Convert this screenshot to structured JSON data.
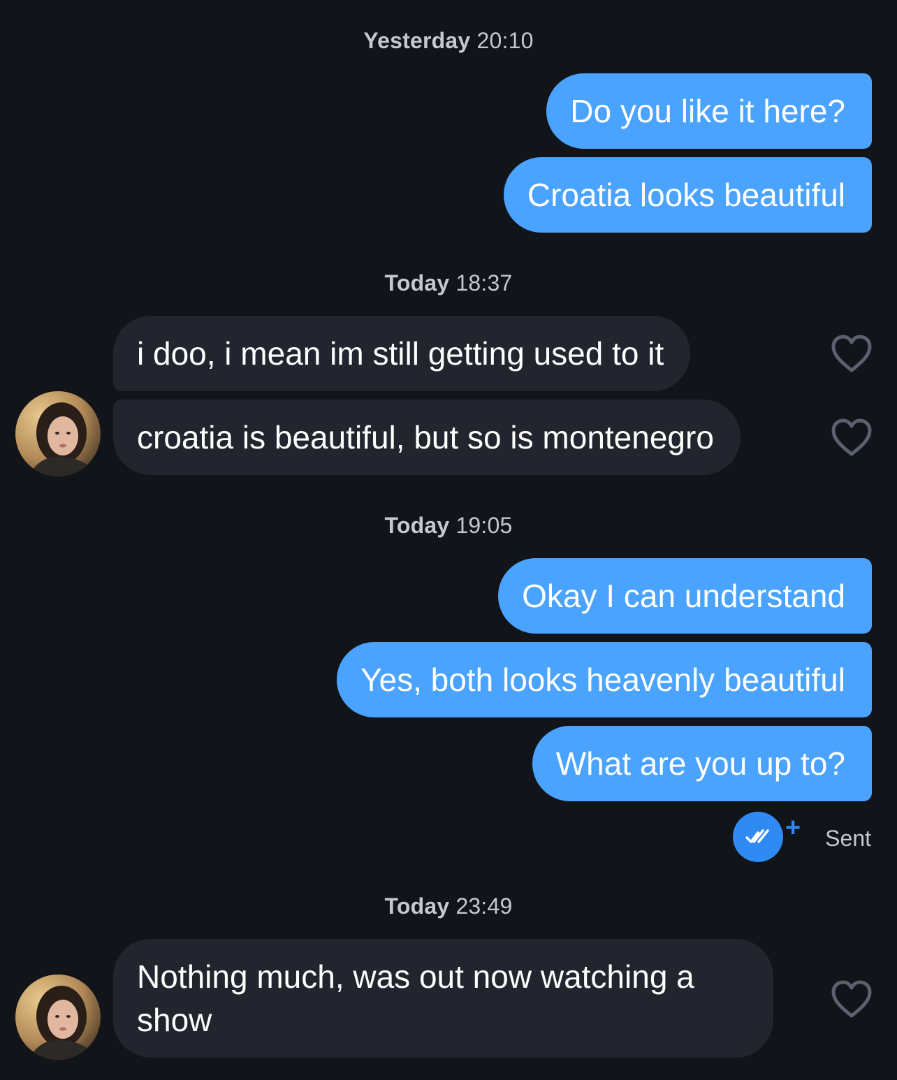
{
  "conversation": {
    "groups": [
      {
        "timestamp_day": "Yesterday",
        "timestamp_time": "20:10",
        "messages": [
          {
            "from": "me",
            "text": "Do you like it here?"
          },
          {
            "from": "me",
            "text": "Croatia looks beautiful"
          }
        ]
      },
      {
        "timestamp_day": "Today",
        "timestamp_time": "18:37",
        "messages": [
          {
            "from": "them",
            "text": "i doo, i mean im still getting used to it"
          },
          {
            "from": "them",
            "text": "croatia is beautiful, but so is montenegro"
          }
        ]
      },
      {
        "timestamp_day": "Today",
        "timestamp_time": "19:05",
        "messages": [
          {
            "from": "me",
            "text": "Okay I can understand"
          },
          {
            "from": "me",
            "text": "Yes, both looks heavenly beautiful"
          },
          {
            "from": "me",
            "text": "What are you up to?"
          }
        ]
      },
      {
        "timestamp_day": "Today",
        "timestamp_time": "23:49",
        "messages": [
          {
            "from": "them",
            "text": "Nothing much, was out now watching a show"
          }
        ]
      }
    ],
    "status": {
      "label": "Sent",
      "plus": "+",
      "icon": "double-check-icon"
    }
  },
  "colors": {
    "background": "#111418",
    "outgoing_bubble": "#4aa3ff",
    "incoming_bubble": "#22252d",
    "timestamp_text": "#c4c8d2",
    "status_accent": "#2f8bf3"
  }
}
